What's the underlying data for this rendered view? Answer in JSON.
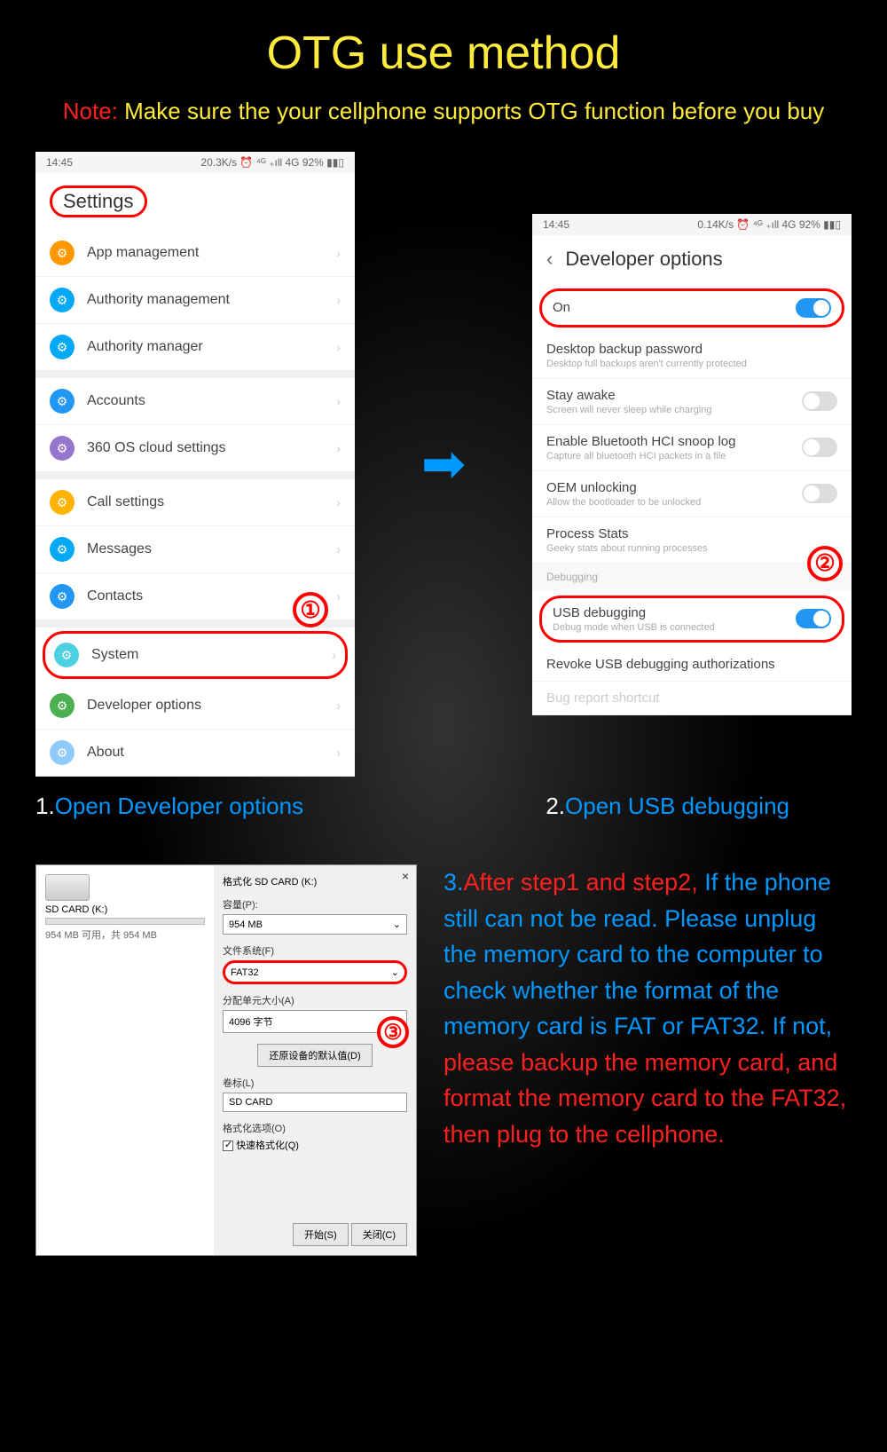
{
  "title": "OTG use method",
  "note": {
    "label": "Note:",
    "text": "Make sure the your cellphone supports OTG function before you buy"
  },
  "phone1": {
    "time": "14:45",
    "status": "20.3K/s ⏰ ⁴ᴳ ₊ıll 4G 92% ▮▮▯",
    "header": "Settings",
    "rows": [
      {
        "icon_color": "#ff9800",
        "label": "App management"
      },
      {
        "icon_color": "#03a9f4",
        "label": "Authority management"
      },
      {
        "icon_color": "#03a9f4",
        "label": "Authority manager"
      },
      {
        "gap": true
      },
      {
        "icon_color": "#2196f3",
        "label": "Accounts"
      },
      {
        "icon_color": "#9575cd",
        "label": "360 OS cloud settings"
      },
      {
        "gap": true
      },
      {
        "icon_color": "#ffb300",
        "label": "Call settings"
      },
      {
        "icon_color": "#03a9f4",
        "label": "Messages"
      },
      {
        "icon_color": "#2196f3",
        "label": "Contacts"
      },
      {
        "gap": true
      },
      {
        "icon_color": "#4dd0e1",
        "label": "System",
        "highlighted": true
      },
      {
        "icon_color": "#4caf50",
        "label": "Developer options"
      },
      {
        "icon_color": "#90caf9",
        "label": "About"
      }
    ],
    "badge": "①"
  },
  "phone2": {
    "time": "14:45",
    "status": "0.14K/s ⏰ ⁴ᴳ ₊ıll 4G 92% ▮▮▯",
    "header": "Developer options",
    "rows": [
      {
        "title": "On",
        "highlighted": true,
        "toggle": "on"
      },
      {
        "title": "Desktop backup password",
        "sub": "Desktop full backups aren't currently protected"
      },
      {
        "title": "Stay awake",
        "sub": "Screen will never sleep while charging",
        "toggle": "off"
      },
      {
        "title": "Enable Bluetooth HCI snoop log",
        "sub": "Capture all bluetooth HCI packets in a file",
        "toggle": "off"
      },
      {
        "title": "OEM unlocking",
        "sub": "Allow the bootloader to be unlocked",
        "toggle": "off"
      },
      {
        "title": "Process Stats",
        "sub": "Geeky stats about running processes"
      },
      {
        "section": "Debugging"
      },
      {
        "title": "USB debugging",
        "sub": "Debug mode when USB is connected",
        "highlighted": true,
        "toggle": "on"
      },
      {
        "title": "Revoke USB debugging authorizations"
      },
      {
        "title": "Bug report shortcut",
        "faded": true
      }
    ],
    "badge": "②"
  },
  "arrow_glyph": "➡",
  "caption1": {
    "num": "1.",
    "text": "Open Developer options"
  },
  "caption2": {
    "num": "2.",
    "text": "Open USB debugging"
  },
  "fat_label": "FAT or FAT32",
  "fat_arrow": "➡",
  "win": {
    "left_title": "SD CARD (K:)",
    "left_info": "954 MB 可用，共 954 MB",
    "right_title": "格式化 SD CARD (K:)",
    "close": "×",
    "capacity_label": "容量(P):",
    "capacity_value": "954 MB",
    "fs_label": "文件系统(F)",
    "fs_value": "FAT32",
    "alloc_label": "分配单元大小(A)",
    "alloc_value": "4096 字节",
    "restore_btn": "还原设备的默认值(D)",
    "vol_label": "卷标(L)",
    "vol_value": "SD CARD",
    "opts_label": "格式化选项(O)",
    "quick_label": "快速格式化(Q)",
    "start_btn": "开始(S)",
    "close_btn": "关闭(C)",
    "badge": "③"
  },
  "step3": {
    "num": "3.",
    "part1": "After step1 and step2,",
    "part2": "If the phone still can not be read. Please unplug the memory card to the computer to check whether the format of the memory card is FAT or FAT32.",
    "part3a": "If not, ",
    "part3b": "please backup the memory card, and format the memory card to the FAT32, then plug to the cellphone."
  }
}
